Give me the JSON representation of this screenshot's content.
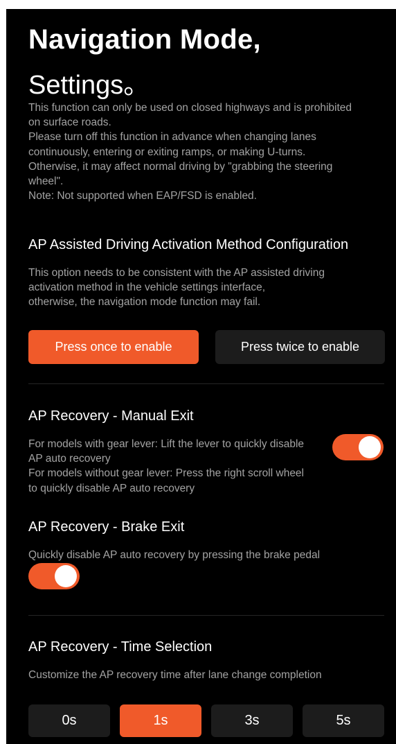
{
  "header": {
    "title_line1": "Navigation Mode,",
    "title_line2": "Settings。"
  },
  "notice": {
    "lines": [
      "This function can only be used on closed highways and is prohibited",
      "on surface roads.",
      "Please turn off this function in advance when changing lanes",
      "continuously, entering or exiting ramps, or making U-turns.",
      "Otherwise, it may affect normal driving by \"grabbing the steering",
      "wheel\".",
      "Note: Not supported when EAP/FSD is enabled."
    ]
  },
  "activation": {
    "title": "AP Assisted Driving Activation Method Configuration",
    "desc_lines": [
      "This option needs to be consistent with the AP assisted driving",
      "activation method in the vehicle settings interface,",
      "otherwise, the navigation mode function may fail."
    ],
    "options": [
      {
        "label": "Press once to enable",
        "selected": true
      },
      {
        "label": "Press twice to enable",
        "selected": false
      }
    ]
  },
  "manual_exit": {
    "title": "AP Recovery - Manual Exit",
    "desc_lines": [
      "For models with gear lever: Lift the lever to quickly disable",
      "AP auto recovery",
      "For models without gear lever: Press the right scroll wheel",
      "to quickly disable AP auto recovery"
    ],
    "enabled": true
  },
  "brake_exit": {
    "title": "AP Recovery - Brake Exit",
    "desc": "Quickly disable AP auto recovery by pressing the brake pedal",
    "enabled": true
  },
  "time_selection": {
    "title": "AP Recovery - Time Selection",
    "desc": "Customize the AP recovery time after lane change completion",
    "options": [
      {
        "label": "0s",
        "selected": false
      },
      {
        "label": "1s",
        "selected": true
      },
      {
        "label": "3s",
        "selected": false
      },
      {
        "label": "5s",
        "selected": false
      }
    ]
  },
  "colors": {
    "accent": "#f05a2a",
    "background": "#000000",
    "inactive_button": "#1c1c1c",
    "secondary_text": "#a3a3a3"
  }
}
